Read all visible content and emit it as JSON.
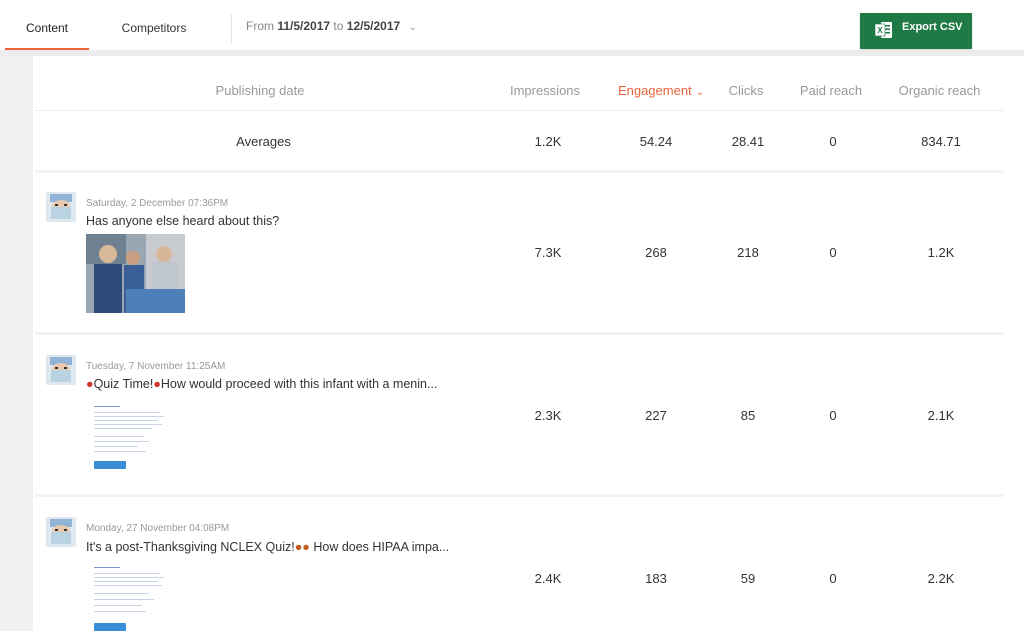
{
  "tabs": [
    {
      "label": "Content",
      "active": true
    },
    {
      "label": "Competitors",
      "active": false
    }
  ],
  "date_range": {
    "prefix": "From",
    "start": "11/5/2017",
    "mid": "to",
    "end": "12/5/2017"
  },
  "export": {
    "label": "Export CSV",
    "icon": "excel-icon",
    "color": "#1f7a46"
  },
  "accent_color": "#e8633d",
  "columns": {
    "publishing_date": "Publishing date",
    "impressions": "Impressions",
    "engagement": "Engagement",
    "clicks": "Clicks",
    "paid_reach": "Paid reach",
    "organic_reach": "Organic reach"
  },
  "averages": {
    "label": "Averages",
    "impressions": "1.2K",
    "engagement": "54.24",
    "clicks": "28.41",
    "paid_reach": "0",
    "organic_reach": "834.71"
  },
  "posts": [
    {
      "date": "Saturday, 2 December 07:36PM",
      "text": "Has anyone else heard about this?",
      "impressions": "7.3K",
      "engagement": "268",
      "clicks": "218",
      "paid_reach": "0",
      "organic_reach": "1.2K"
    },
    {
      "date": "Tuesday, 7 November 11:25AM",
      "text": "Quiz Time!",
      "text2": "How would proceed with this infant with a menin...",
      "impressions": "2.3K",
      "engagement": "227",
      "clicks": "85",
      "paid_reach": "0",
      "organic_reach": "2.1K"
    },
    {
      "date": "Monday, 27 November 04:08PM",
      "text": "It's a post-Thanksgiving NCLEX Quiz!",
      "text2": "How does HIPAA impa...",
      "impressions": "2.4K",
      "engagement": "183",
      "clicks": "59",
      "paid_reach": "0",
      "organic_reach": "2.2K"
    }
  ]
}
